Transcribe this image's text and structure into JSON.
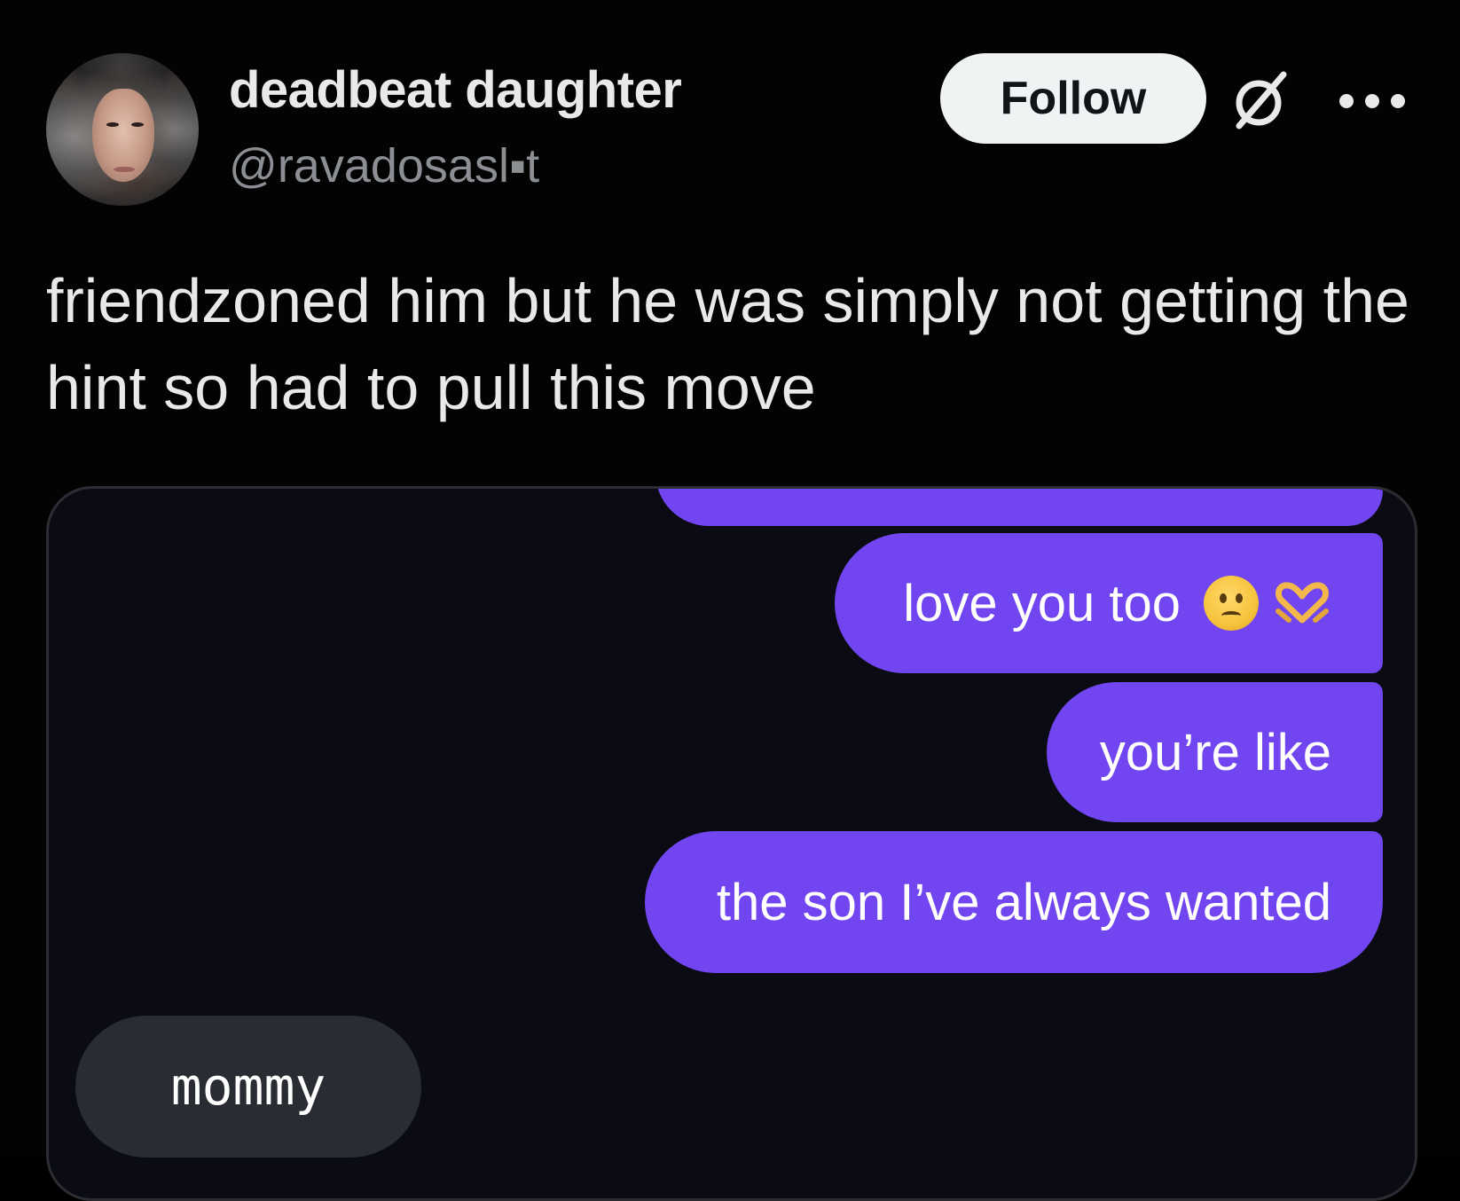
{
  "author": {
    "display_name": "deadbeat daughter",
    "handle": "@ravadosasl▪t"
  },
  "actions": {
    "follow_label": "Follow",
    "grok_icon": "grok-slash-circle-icon",
    "more_icon": "more-dots-icon"
  },
  "post": {
    "text": "friendzoned him but he was simply not getting the hint so had to pull this move"
  },
  "chat": {
    "outgoing": [
      {
        "text": "love you too",
        "emojis": [
          "frowning-face",
          "heart-hands"
        ]
      },
      {
        "text": "you’re like"
      },
      {
        "text": "the son I’ve always wanted"
      }
    ],
    "incoming": [
      {
        "text": "mommy"
      }
    ]
  },
  "colors": {
    "background": "#030303",
    "outgoing_bubble": "#7146f0",
    "incoming_bubble": "#2a2c33",
    "follow_button": "#eff3f4",
    "handle_text": "#8b8f94"
  }
}
